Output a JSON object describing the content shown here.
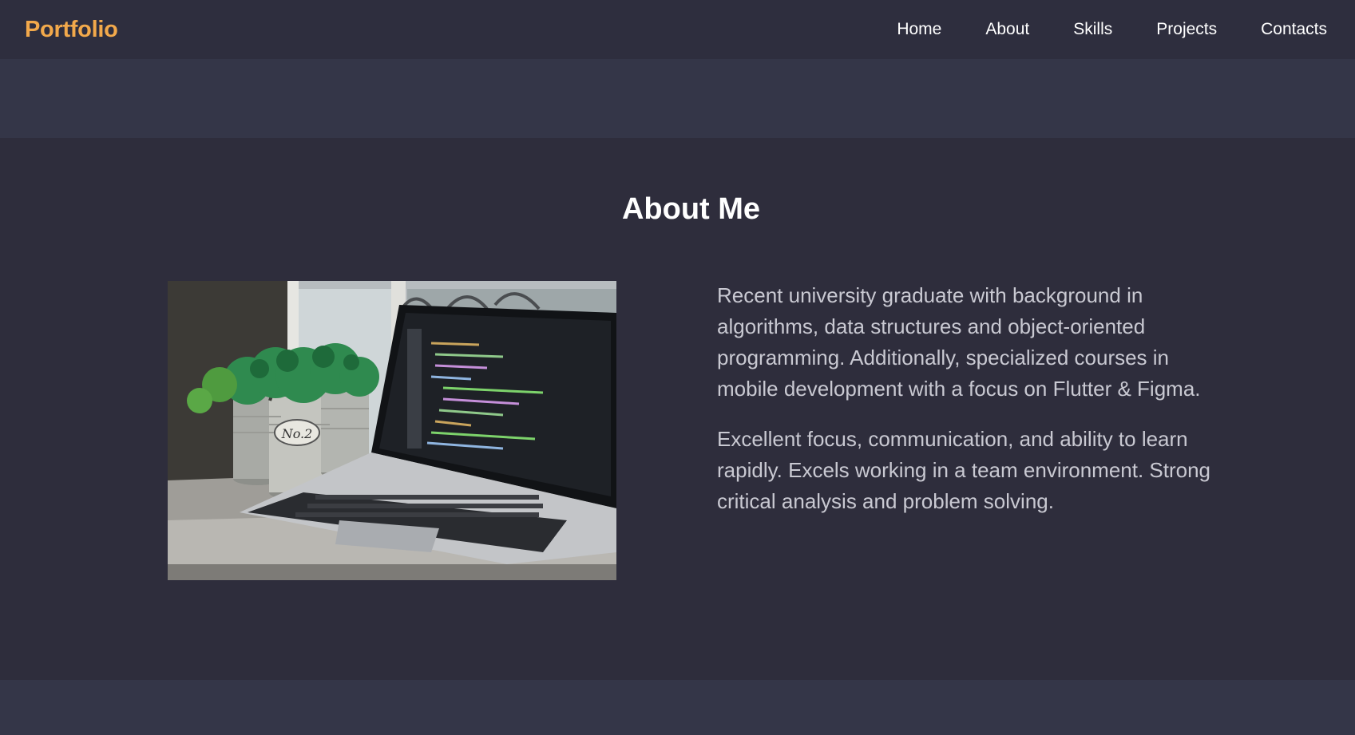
{
  "brand": "Portfolio",
  "nav": {
    "items": [
      {
        "label": "Home"
      },
      {
        "label": "About"
      },
      {
        "label": "Skills"
      },
      {
        "label": "Projects"
      },
      {
        "label": "Contacts"
      }
    ]
  },
  "about": {
    "title": "About Me",
    "paragraphs": [
      "Recent university graduate with background in algorithms, data structures and object-oriented programming. Additionally, specialized courses in mobile development with a focus on Flutter & Figma.",
      "Excellent focus, communication, and ability to learn rapidly. Excels working in a team environment. Strong critical analysis and problem solving."
    ],
    "image_plant_label": "No.2"
  },
  "colors": {
    "brand": "#f2a94b",
    "nav_bg": "#2e2e3e",
    "section_bg": "#2e2d3c",
    "band_bg": "#343648",
    "text_light": "#c9c9d2"
  }
}
